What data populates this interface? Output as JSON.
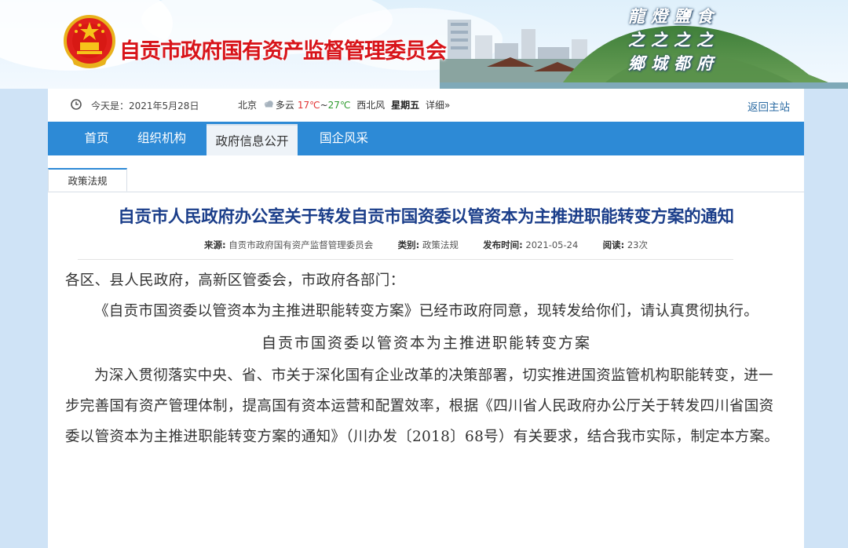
{
  "header": {
    "site_title": "自贡市政府国有资产监督管理委员会",
    "calligraphy": [
      "龍燈鹽食",
      "之之之之",
      "鄉城都府"
    ]
  },
  "infobar": {
    "today": "今天是：2021年5月28日",
    "city": "北京",
    "weather": "多云",
    "temp_high": "17℃",
    "temp_sep": "~",
    "temp_low": "27℃",
    "wind": "西北风",
    "weekday": "星期五",
    "details": "详细»",
    "back_home": "返回主站"
  },
  "nav": {
    "items": [
      "首页",
      "组织机构",
      "政府信息公开",
      "国企风采"
    ],
    "active_index": 2
  },
  "breadcrumb_tab": "政策法规",
  "article": {
    "title": "自贡市人民政府办公室关于转发自贡市国资委以管资本为主推进职能转变方案的通知",
    "meta": {
      "source_label": "来源:",
      "source": "自贡市政府国有资产监督管理委员会",
      "category_label": "类别:",
      "category": "政策法规",
      "date_label": "发布时间:",
      "date": "2021-05-24",
      "views_label": "阅读:",
      "views": "23次"
    },
    "salutation": "各区、县人民政府，高新区管委会，市政府各部门：",
    "para1": "《自贡市国资委以管资本为主推进职能转变方案》已经市政府同意，现转发给你们，请认真贯彻执行。",
    "subtitle": "自贡市国资委以管资本为主推进职能转变方案",
    "para2": "为深入贯彻落实中央、省、市关于深化国有企业改革的决策部署，切实推进国资监管机构职能转变，进一步完善国有资产管理体制，提高国有资本运营和配置效率，根据《四川省人民政府办公厅关于转发四川省国资委以管资本为主推进职能转变方案的通知》（川办发〔2018〕68号）有关要求，结合我市实际，制定本方案。"
  },
  "colors": {
    "title_red": "#d8141a",
    "nav_blue": "#2d8ad6",
    "article_title_blue": "#1b3e8a",
    "temp_high": "#e23333",
    "temp_low": "#2e9b2e"
  }
}
